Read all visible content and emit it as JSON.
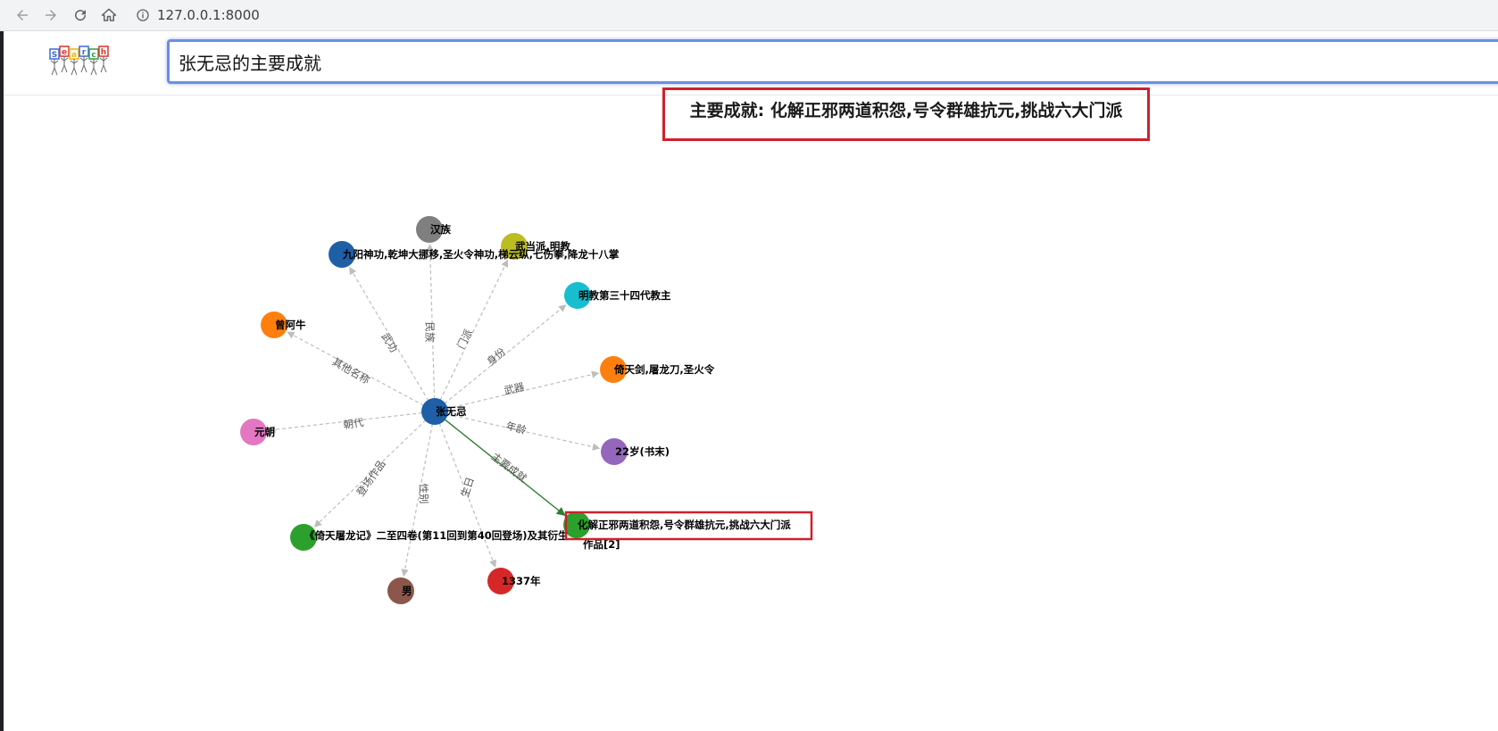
{
  "browser": {
    "url": "127.0.0.1:8000",
    "icons": [
      "back-arrow-icon",
      "forward-arrow-icon",
      "reload-icon",
      "home-icon",
      "info-icon"
    ]
  },
  "header": {
    "logo_text": "Search",
    "logo_colors": [
      "#3b6ad6",
      "#d9342b",
      "#f2b400",
      "#3b6ad6",
      "#2f9e44",
      "#d9342b"
    ],
    "query": "张无忌的主要成就"
  },
  "answer": {
    "text": "主要成就: 化解正邪两道积怨,号令群雄抗元,挑战六大门派",
    "border_color": "#d2202b"
  },
  "graph": {
    "center": {
      "id": "zwj",
      "label": "张无忌",
      "color": "#1f5fa8"
    },
    "nodes": [
      {
        "id": "n1",
        "label": "汉族",
        "color": "#7f7f7f",
        "edge_label": "民族"
      },
      {
        "id": "n2",
        "label": "武当派,明教",
        "color": "#bcbd22",
        "edge_label": "门派"
      },
      {
        "id": "n3",
        "label": "九阳神功,乾坤大挪移,圣火令神功,梯云纵,七伤拳,降龙十八掌",
        "color": "#1f5fa8",
        "edge_label": "武功"
      },
      {
        "id": "n4",
        "label": "明教第三十四代教主",
        "color": "#17becf",
        "edge_label": "身份"
      },
      {
        "id": "n5",
        "label": "曾阿牛",
        "color": "#ff7f0e",
        "edge_label": "其他名称"
      },
      {
        "id": "n6",
        "label": "倚天剑,屠龙刀,圣火令",
        "color": "#ff7f0e",
        "edge_label": "武器"
      },
      {
        "id": "n7",
        "label": "元朝",
        "color": "#e377c2",
        "edge_label": "朝代"
      },
      {
        "id": "n8",
        "label": "22岁(书末)",
        "color": "#9467bd",
        "edge_label": "年龄"
      },
      {
        "id": "n9",
        "label": "化解正邪两道积怨,号令群雄抗元,挑战六大门派",
        "color": "#2ca02c",
        "edge_label": "主要成就",
        "highlight": true
      },
      {
        "id": "n10",
        "label": "《倚天屠龙记》二至四卷(第11回到第40回登场)及其衍生作品[2]",
        "color": "#2ca02c",
        "edge_label": "登场作品"
      },
      {
        "id": "n11",
        "label": "男",
        "color": "#8c564b",
        "edge_label": "性别"
      },
      {
        "id": "n12",
        "label": "1337年",
        "color": "#d62728",
        "edge_label": "生日"
      }
    ],
    "edge_color": "#bdbdbd",
    "highlight_edge_color": "#2e7d32",
    "highlight_box_color": "#d2202b"
  }
}
